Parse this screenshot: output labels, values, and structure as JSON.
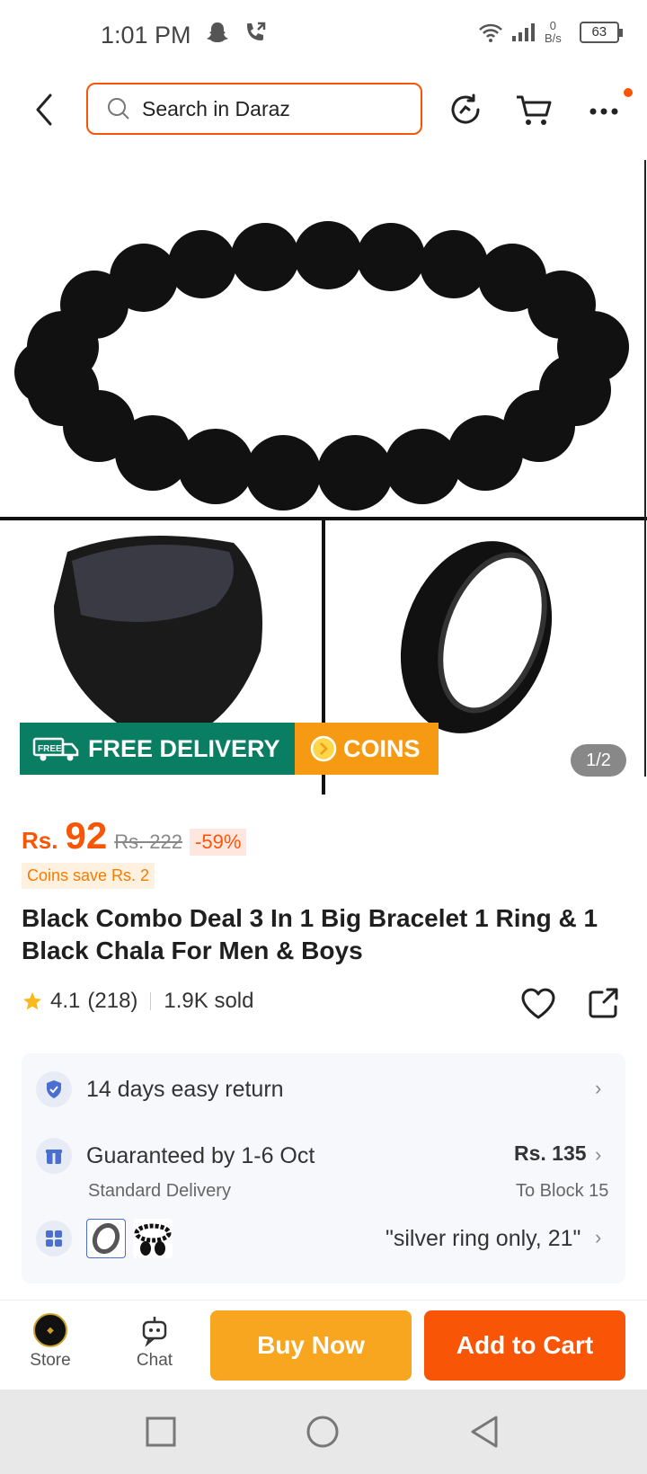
{
  "status_bar": {
    "time": "1:01 PM",
    "netspeed_value": "0",
    "netspeed_unit": "B/s",
    "battery": "63"
  },
  "top_bar": {
    "search_placeholder": "Search in Daraz"
  },
  "gallery": {
    "free_delivery": "FREE DELIVERY",
    "free_tag": "FREE",
    "coins": "COINS",
    "page_indicator": "1/2"
  },
  "product": {
    "currency": "Rs.",
    "price": "92",
    "original_price": "Rs. 222",
    "discount": "-59%",
    "coins_save": "Coins save Rs. 2",
    "title": "Black Combo Deal 3 In 1 Big Bracelet 1 Ring & 1 Black Chala For Men & Boys",
    "rating": "4.1",
    "review_count": "(218)",
    "sold": "1.9K sold"
  },
  "info": {
    "return_text": "14 days easy return",
    "delivery_text": "Guaranteed by 1-6 Oct",
    "delivery_sub": "Standard Delivery",
    "delivery_price": "Rs. 135",
    "delivery_location": "To Block 15",
    "variant_text": "\"silver ring only, 21\""
  },
  "bottom_bar": {
    "store_label": "Store",
    "chat_label": "Chat",
    "buy_now": "Buy Now",
    "add_to_cart": "Add to Cart"
  },
  "colors": {
    "brand": "#f85606",
    "buy_now": "#f8a51f",
    "free_delivery": "#0a7e63",
    "coins": "#f79a13"
  }
}
